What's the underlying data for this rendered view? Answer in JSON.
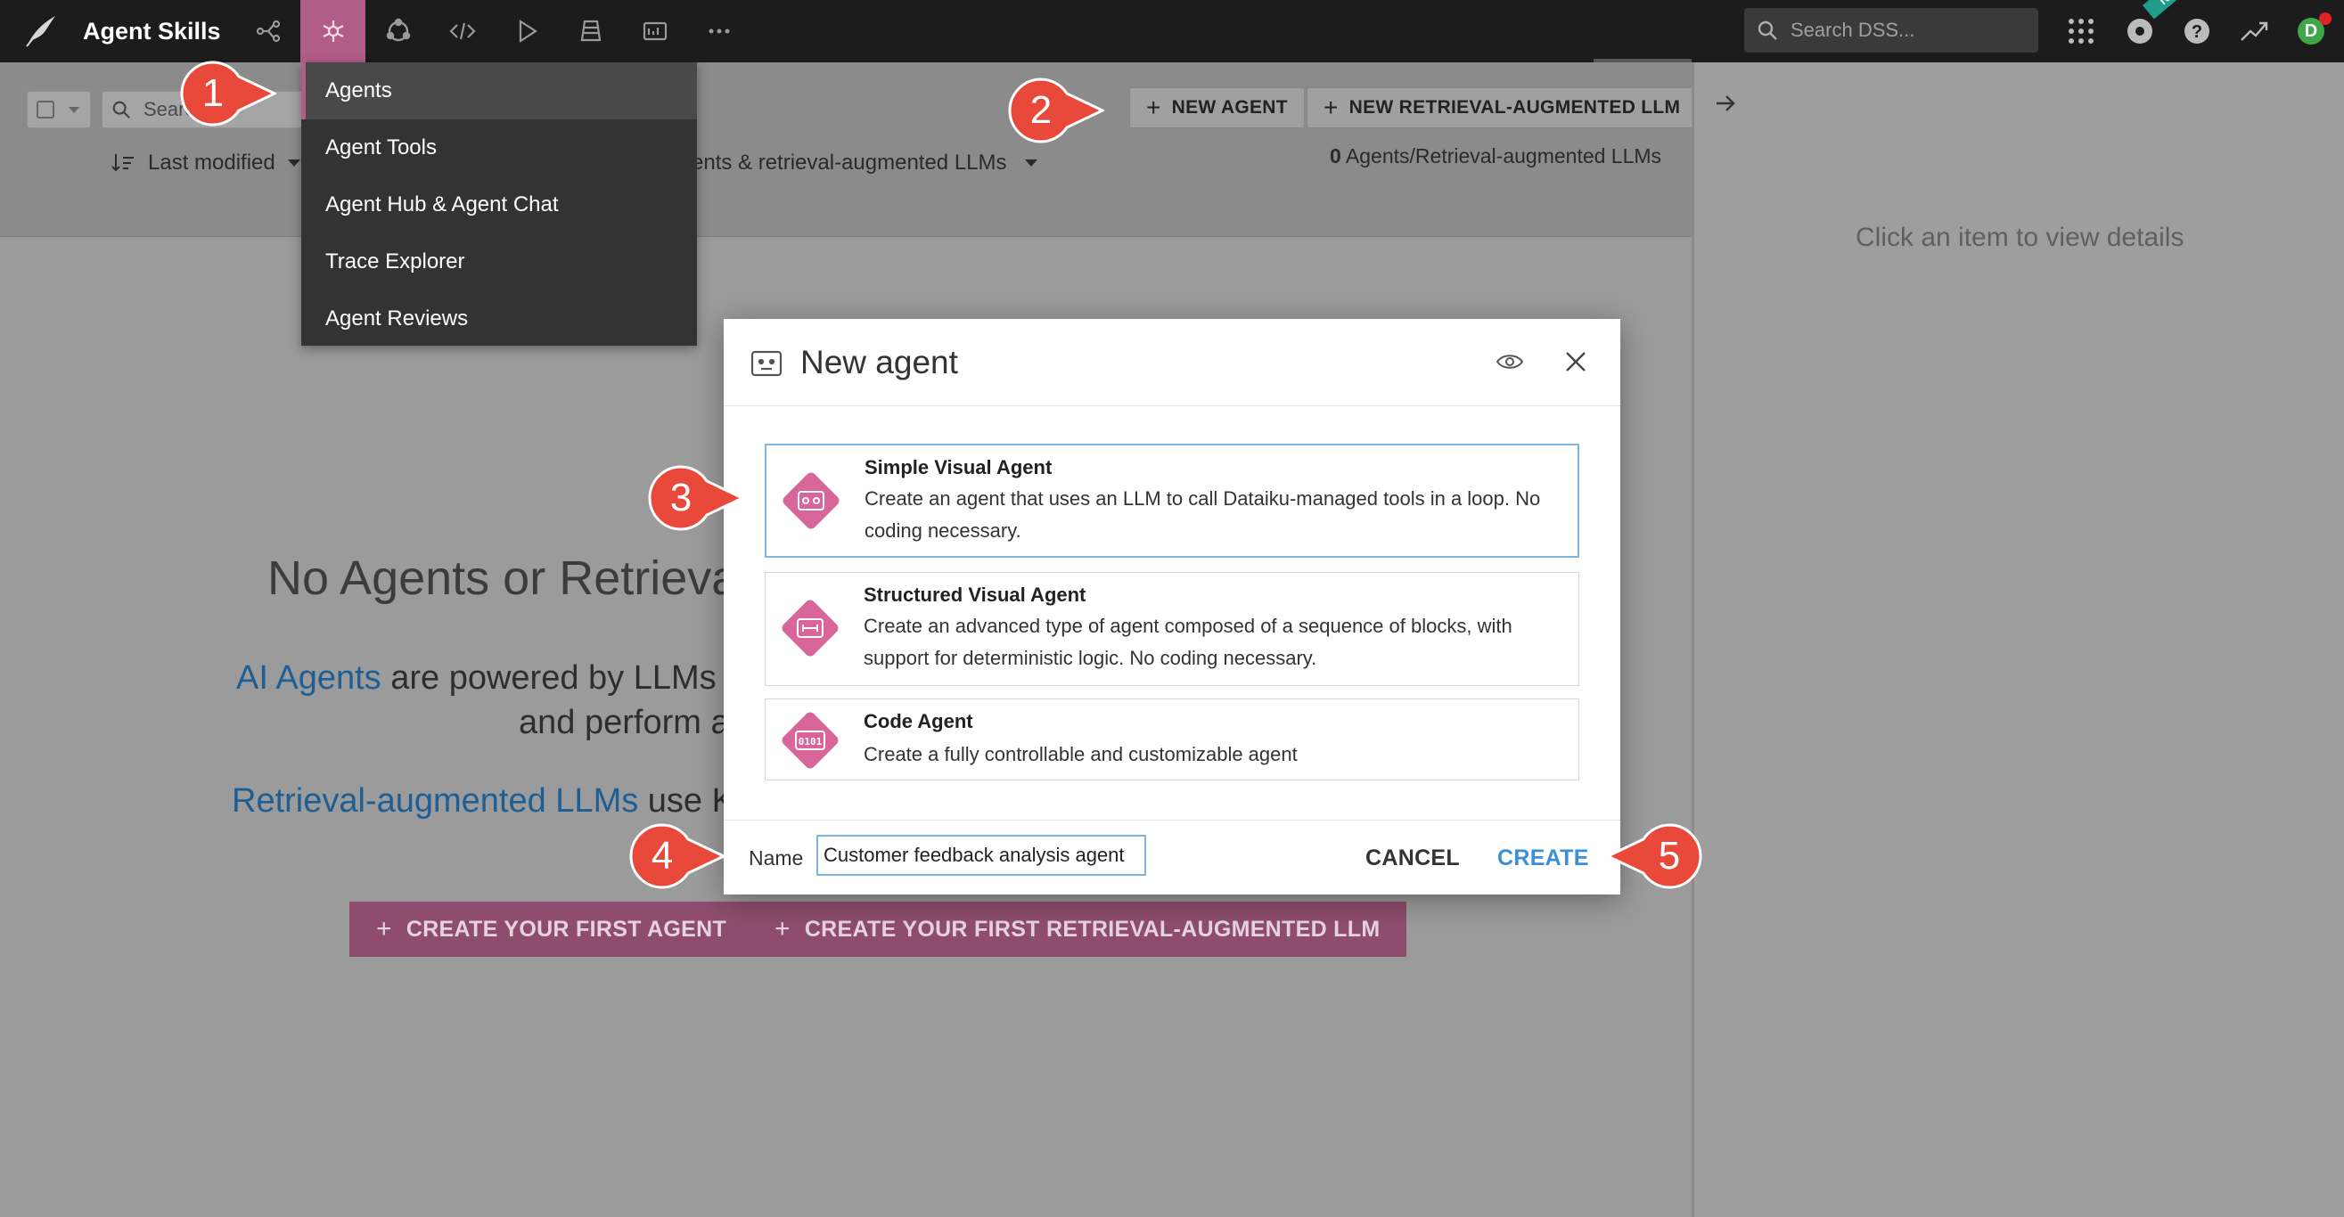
{
  "app": {
    "project_title": "Agent Skills",
    "search_placeholder": "Search DSS...",
    "new_badge": "New",
    "user_initial": "D"
  },
  "dropdown": {
    "items": [
      {
        "label": "Agents",
        "selected": true
      },
      {
        "label": "Agent Tools"
      },
      {
        "label": "Agent Hub & Agent Chat"
      },
      {
        "label": "Trace Explorer"
      },
      {
        "label": "Agent Reviews"
      }
    ]
  },
  "toolbar": {
    "search_placeholder": "Search",
    "sort_label": "Last modified",
    "filter_label": "ents & retrieval-augmented LLMs",
    "new_agent_label": "NEW AGENT",
    "new_rag_label": "NEW RETRIEVAL-AUGMENTED LLM",
    "count_number": "0",
    "count_label": " Agents/Retrieval-augmented LLMs"
  },
  "empty_state": {
    "title": "No Agents or Retrieva",
    "p1_link": "AI Agents",
    "p1_text": " are powered by LLMs ar",
    "p1b_text": "and perform a",
    "p2_link": "Retrieval-augmented LLMs",
    "p2_text": " use Kr",
    "cta_agent": "CREATE YOUR FIRST AGENT",
    "cta_rag": "CREATE YOUR FIRST RETRIEVAL-AUGMENTED LLM"
  },
  "right_panel": {
    "hint": "Click an item to view details"
  },
  "modal": {
    "title": "New agent",
    "options": [
      {
        "title": "Simple Visual Agent",
        "desc": "Create an agent that uses an LLM to call Dataiku-managed tools in a loop. No coding necessary.",
        "selected": true
      },
      {
        "title": "Structured Visual Agent",
        "desc": "Create an advanced type of agent composed of a sequence of blocks, with support for deterministic logic. No coding necessary."
      },
      {
        "title": "Code Agent",
        "desc": "Create a fully controllable and customizable agent"
      }
    ],
    "name_label": "Name",
    "name_value": "Customer feedback analysis agent",
    "cancel_label": "CANCEL",
    "create_label": "CREATE"
  },
  "callouts": [
    "1",
    "2",
    "3",
    "4",
    "5"
  ],
  "colors": {
    "accent": "#b25c88",
    "link": "#3b8fd6",
    "callout": "#e8493a"
  }
}
